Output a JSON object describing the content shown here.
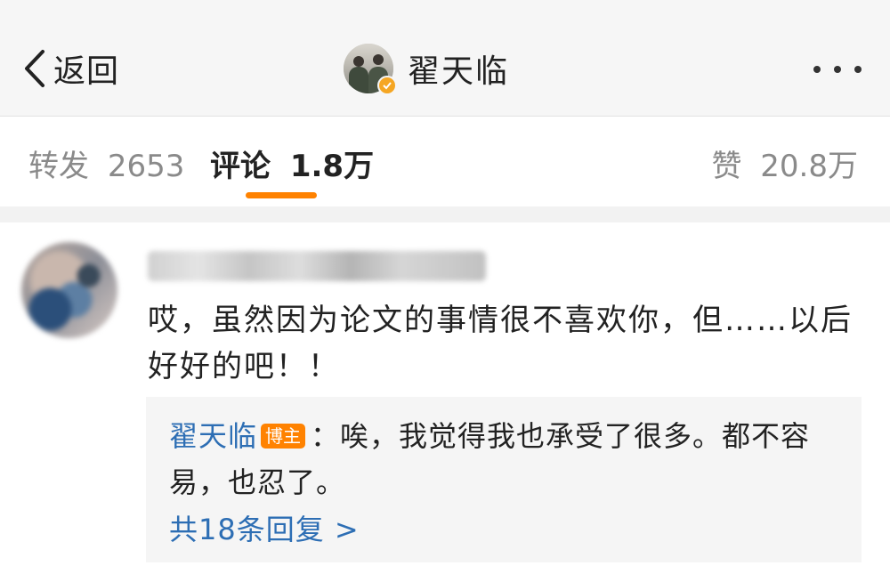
{
  "header": {
    "back_label": "返回",
    "title": "翟天临",
    "back_icon": "chevron-left-icon",
    "more_icon": "more-dots-icon",
    "verified_icon": "verified-badge-icon"
  },
  "tabs": {
    "repost": {
      "label": "转发",
      "count": "2653"
    },
    "comments": {
      "label": "评论",
      "count": "1.8万"
    },
    "likes": {
      "label": "赞",
      "count": "20.8万"
    },
    "active_color": "#ff8200"
  },
  "comment": {
    "text": "哎，虽然因为论文的事情很不喜欢你，但……以后好好的吧！！",
    "reply": {
      "author": "翟天临",
      "badge": "博主",
      "separator": "：",
      "text": "唉，我觉得我也承受了很多。都不容易，也忍了。"
    },
    "more_replies": "共18条回复 >"
  },
  "colors": {
    "link": "#2d6eb4",
    "accent": "#ff8200",
    "header_bg": "#f6f6f6"
  }
}
